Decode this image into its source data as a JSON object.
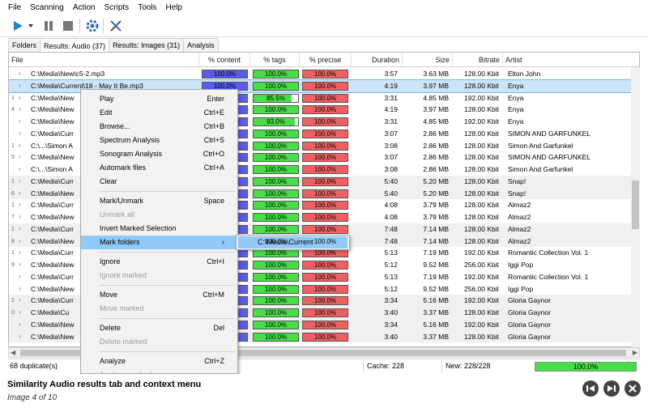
{
  "menubar": [
    "File",
    "Scanning",
    "Action",
    "Scripts",
    "Tools",
    "Help"
  ],
  "toolbar": {
    "icons": [
      "play-icon",
      "dropdown-arrow-icon",
      "pause-icon",
      "stop-icon",
      "settings-gear-icon",
      "tools-icon"
    ]
  },
  "tabs": [
    {
      "label": "Folders",
      "active": false
    },
    {
      "label": "Results: Audio (37)",
      "active": true
    },
    {
      "label": "Results: Images (31)",
      "active": false
    },
    {
      "label": "Analysis",
      "active": false
    }
  ],
  "columns": [
    "File",
    "% content",
    "% tags",
    "% precise",
    "Duration",
    "Size",
    "Bitrate",
    "Artist"
  ],
  "rows": [
    {
      "file": "C:\\Media\\New\\c5-2.mp3",
      "content": "100.0%",
      "content_pct": 100,
      "tags": "100.0%",
      "tags_pct": 100,
      "precise": "100.0%",
      "precise_pct": 100,
      "duration": "3:57",
      "size": "3.63 MB",
      "bitrate": "128.00 Kbit",
      "artist": "Elton John",
      "group": "",
      "grp_alt": false
    },
    {
      "file": "C:\\Media\\Current\\18 - May It Be.mp3",
      "content": "100.0%",
      "content_pct": 100,
      "tags": "100.0%",
      "tags_pct": 100,
      "precise": "100.0%",
      "precise_pct": 100,
      "duration": "4:19",
      "size": "3.97 MB",
      "bitrate": "128.00 Kbit",
      "artist": "Enya",
      "group": "",
      "grp_alt": false,
      "selected": true
    },
    {
      "file": "C:\\Media\\New",
      "content": "",
      "content_pct": 100,
      "tags": "85.5%",
      "tags_pct": 85.5,
      "precise": "100.0%",
      "precise_pct": 100,
      "duration": "3:31",
      "size": "4.85 MB",
      "bitrate": "192.00 Kbit",
      "artist": "Enya",
      "group": "1",
      "grp_alt": false
    },
    {
      "file": "C:\\Media\\New",
      "content": "",
      "content_pct": 100,
      "tags": "100.0%",
      "tags_pct": 100,
      "precise": "100.0%",
      "precise_pct": 100,
      "duration": "4:19",
      "size": "3.97 MB",
      "bitrate": "128.00 Kbit",
      "artist": "Enya",
      "group": "4",
      "grp_alt": false
    },
    {
      "file": "C:\\Media\\New",
      "content": "",
      "content_pct": 100,
      "tags": "93.0%",
      "tags_pct": 93,
      "precise": "100.0%",
      "precise_pct": 100,
      "duration": "3:31",
      "size": "4.85 MB",
      "bitrate": "192.00 Kbit",
      "artist": "Enya",
      "group": "",
      "grp_alt": false
    },
    {
      "file": "C:\\Media\\Curr",
      "content": "",
      "content_pct": 100,
      "tags": "100.0%",
      "tags_pct": 100,
      "precise": "100.0%",
      "precise_pct": 100,
      "duration": "3:07",
      "size": "2.86 MB",
      "bitrate": "128.00 Kbit",
      "artist": "SIMON AND GARFUNKEL",
      "group": "",
      "grp_alt": false
    },
    {
      "file": "C:\\...\\Simon A",
      "content": "",
      "content_pct": 100,
      "tags": "100.0%",
      "tags_pct": 100,
      "precise": "100.0%",
      "precise_pct": 100,
      "duration": "3:08",
      "size": "2.86 MB",
      "bitrate": "128.00 Kbit",
      "artist": "Simon And Garfunkel",
      "group": "1",
      "grp_alt": false
    },
    {
      "file": "C:\\Media\\New",
      "content": "",
      "content_pct": 100,
      "tags": "100.0%",
      "tags_pct": 100,
      "precise": "100.0%",
      "precise_pct": 100,
      "duration": "3:07",
      "size": "2.86 MB",
      "bitrate": "128.00 Kbit",
      "artist": "SIMON AND GARFUNKEL",
      "group": "5",
      "grp_alt": false
    },
    {
      "file": "C:\\...\\Simon A",
      "content": "",
      "content_pct": 100,
      "tags": "100.0%",
      "tags_pct": 100,
      "precise": "100.0%",
      "precise_pct": 100,
      "duration": "3:08",
      "size": "2.86 MB",
      "bitrate": "128.00 Kbit",
      "artist": "Simon And Garfunkel",
      "group": "",
      "grp_alt": false
    },
    {
      "file": "C:\\Media\\Curr",
      "content": "",
      "content_pct": 100,
      "tags": "100.0%",
      "tags_pct": 100,
      "precise": "100.0%",
      "precise_pct": 100,
      "duration": "5:40",
      "size": "5.20 MB",
      "bitrate": "128.00 Kbit",
      "artist": "Snap!",
      "group": "1",
      "grp_alt": true
    },
    {
      "file": "C:\\Media\\New",
      "content": "",
      "content_pct": 100,
      "tags": "100.0%",
      "tags_pct": 100,
      "precise": "100.0%",
      "precise_pct": 100,
      "duration": "5:40",
      "size": "5.20 MB",
      "bitrate": "128.00 Kbit",
      "artist": "Snap!",
      "group": "6",
      "grp_alt": true
    },
    {
      "file": "C:\\Media\\Curr",
      "content": "",
      "content_pct": 100,
      "tags": "100.0%",
      "tags_pct": 100,
      "precise": "100.0%",
      "precise_pct": 100,
      "duration": "4:08",
      "size": "3.79 MB",
      "bitrate": "128.00 Kbit",
      "artist": "Almaz2",
      "group": "1",
      "grp_alt": false
    },
    {
      "file": "C:\\Media\\New",
      "content": "",
      "content_pct": 100,
      "tags": "100.0%",
      "tags_pct": 100,
      "precise": "100.0%",
      "precise_pct": 100,
      "duration": "4:08",
      "size": "3.79 MB",
      "bitrate": "128.00 Kbit",
      "artist": "Almaz2",
      "group": "7",
      "grp_alt": false
    },
    {
      "file": "C:\\Media\\Curr",
      "content": "",
      "content_pct": 100,
      "tags": "100.0%",
      "tags_pct": 100,
      "precise": "100.0%",
      "precise_pct": 100,
      "duration": "7:48",
      "size": "7.14 MB",
      "bitrate": "128.00 Kbit",
      "artist": "Almaz2",
      "group": "1",
      "grp_alt": true
    },
    {
      "file": "C:\\Media\\New",
      "content": "",
      "content_pct": 100,
      "tags": "100.0%",
      "tags_pct": 100,
      "precise": "100.0%",
      "precise_pct": 100,
      "duration": "7:48",
      "size": "7.14 MB",
      "bitrate": "128.00 Kbit",
      "artist": "Almaz2",
      "group": "8",
      "grp_alt": true
    },
    {
      "file": "C:\\Media\\Curr",
      "content": "",
      "content_pct": 100,
      "tags": "100.0%",
      "tags_pct": 100,
      "precise": "100.0%",
      "precise_pct": 100,
      "duration": "5:13",
      "size": "7.19 MB",
      "bitrate": "192.00 Kbit",
      "artist": "Romantic Collection Vol. 1",
      "group": "1",
      "grp_alt": false
    },
    {
      "file": "C:\\Media\\New",
      "content": "",
      "content_pct": 100,
      "tags": "100.0%",
      "tags_pct": 100,
      "precise": "100.0%",
      "precise_pct": 100,
      "duration": "5:12",
      "size": "9.52 MB",
      "bitrate": "256.00 Kbit",
      "artist": "Iggi Pop",
      "group": "9",
      "grp_alt": false
    },
    {
      "file": "C:\\Media\\Curr",
      "content": "",
      "content_pct": 100,
      "tags": "100.0%",
      "tags_pct": 100,
      "precise": "100.0%",
      "precise_pct": 100,
      "duration": "5:13",
      "size": "7.19 MB",
      "bitrate": "192.00 Kbit",
      "artist": "Romantic Collection Vol. 1",
      "group": "",
      "grp_alt": false
    },
    {
      "file": "C:\\Media\\New",
      "content": "",
      "content_pct": 100,
      "tags": "100.0%",
      "tags_pct": 100,
      "precise": "100.0%",
      "precise_pct": 100,
      "duration": "5:12",
      "size": "9.52 MB",
      "bitrate": "256.00 Kbit",
      "artist": "Iggi Pop",
      "group": "",
      "grp_alt": false
    },
    {
      "file": "C:\\Media\\Curr",
      "content": "",
      "content_pct": 100,
      "tags": "100.0%",
      "tags_pct": 100,
      "precise": "100.0%",
      "precise_pct": 100,
      "duration": "3:34",
      "size": "5.16 MB",
      "bitrate": "192.00 Kbit",
      "artist": "Gloria Gaynor",
      "group": "2",
      "grp_alt": true
    },
    {
      "file": "C:\\Media\\Cu",
      "content": "",
      "content_pct": 100,
      "tags": "100.0%",
      "tags_pct": 100,
      "precise": "100.0%",
      "precise_pct": 100,
      "duration": "3:40",
      "size": "3.37 MB",
      "bitrate": "128.00 Kbit",
      "artist": "Gloria Gaynor",
      "group": "0",
      "grp_alt": true
    },
    {
      "file": "C:\\Media\\New",
      "content": "",
      "content_pct": 100,
      "tags": "100.0%",
      "tags_pct": 100,
      "precise": "100.0%",
      "precise_pct": 100,
      "duration": "3:34",
      "size": "5.16 MB",
      "bitrate": "192.00 Kbit",
      "artist": "Gloria Gaynor",
      "group": "",
      "grp_alt": true
    },
    {
      "file": "C:\\Media\\New",
      "content": "",
      "content_pct": 100,
      "tags": "100.0%",
      "tags_pct": 100,
      "precise": "100.0%",
      "precise_pct": 100,
      "duration": "3:40",
      "size": "3.37 MB",
      "bitrate": "128.00 Kbit",
      "artist": "Gloria Gaynor",
      "group": "",
      "grp_alt": true
    }
  ],
  "context_menu": [
    {
      "label": "Play",
      "shortcut": "Enter",
      "disabled": false
    },
    {
      "label": "Edit",
      "shortcut": "Ctrl+E",
      "disabled": false
    },
    {
      "label": "Browse...",
      "shortcut": "Ctrl+B",
      "disabled": false
    },
    {
      "label": "Spectrum Analysis",
      "shortcut": "Ctrl+S",
      "disabled": false
    },
    {
      "label": "Sonogram Analysis",
      "shortcut": "Ctrl+O",
      "disabled": false
    },
    {
      "label": "Automark files",
      "shortcut": "Ctrl+A",
      "disabled": false
    },
    {
      "label": "Clear",
      "shortcut": "",
      "disabled": false
    },
    {
      "sep": true
    },
    {
      "label": "Mark/Unmark",
      "shortcut": "Space",
      "disabled": false
    },
    {
      "label": "Unmark all",
      "shortcut": "",
      "disabled": true
    },
    {
      "label": "Invert Marked Selection",
      "shortcut": "",
      "disabled": false
    },
    {
      "label": "Mark folders",
      "shortcut": "",
      "disabled": false,
      "highlight": true,
      "submenu": true
    },
    {
      "sep": true
    },
    {
      "label": "Ignore",
      "shortcut": "Ctrl+I",
      "disabled": false
    },
    {
      "label": "Ignore marked",
      "shortcut": "",
      "disabled": true
    },
    {
      "sep": true
    },
    {
      "label": "Move",
      "shortcut": "Ctrl+M",
      "disabled": false
    },
    {
      "label": "Move marked",
      "shortcut": "",
      "disabled": true
    },
    {
      "sep": true
    },
    {
      "label": "Delete",
      "shortcut": "Del",
      "disabled": false
    },
    {
      "label": "Delete marked",
      "shortcut": "",
      "disabled": true
    },
    {
      "sep": true
    },
    {
      "label": "Analyze",
      "shortcut": "Ctrl+Z",
      "disabled": false
    },
    {
      "label": "Analyze marked",
      "shortcut": "",
      "disabled": true
    }
  ],
  "submenu": {
    "label": "C:\\Media\\Current"
  },
  "status": {
    "duplicates": "68 duplicate(s)",
    "cache": "Cache: 228",
    "new": "New: 228/228",
    "progress_label": "100.0%",
    "progress_pct": 100
  },
  "caption": {
    "title": "Similarity Audio results tab and context menu",
    "subtitle": "Image 4 of 10"
  },
  "colors": {
    "content_fill": "#5a5af0",
    "tags_fill": "#46e046",
    "precise_fill": "#f06060",
    "selection": "#cce4f7",
    "menu_highlight": "#91c9f7",
    "progress": "#46e046"
  }
}
